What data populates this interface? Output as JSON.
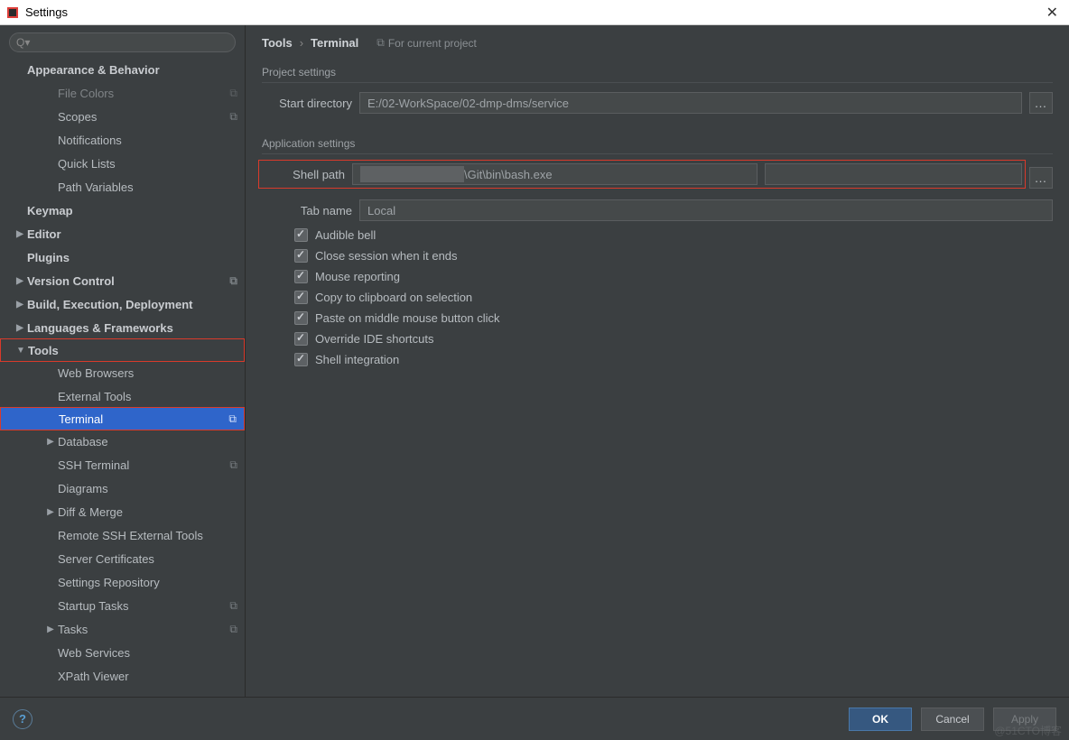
{
  "window": {
    "title": "Settings"
  },
  "search": {
    "placeholder": ""
  },
  "sidebar": {
    "items": [
      {
        "label": "Appearance & Behavior",
        "level": 0,
        "bold": true,
        "arrow": "",
        "badge": ""
      },
      {
        "label": "File Colors",
        "level": 2,
        "bold": false,
        "arrow": "",
        "badge": "⧉",
        "faded": true
      },
      {
        "label": "Scopes",
        "level": 2,
        "bold": false,
        "arrow": "",
        "badge": "⧉"
      },
      {
        "label": "Notifications",
        "level": 2,
        "bold": false,
        "arrow": "",
        "badge": ""
      },
      {
        "label": "Quick Lists",
        "level": 2,
        "bold": false,
        "arrow": "",
        "badge": ""
      },
      {
        "label": "Path Variables",
        "level": 2,
        "bold": false,
        "arrow": "",
        "badge": ""
      },
      {
        "label": "Keymap",
        "level": 0,
        "bold": true,
        "arrow": "",
        "badge": ""
      },
      {
        "label": "Editor",
        "level": 0,
        "bold": true,
        "arrow": "▶",
        "badge": ""
      },
      {
        "label": "Plugins",
        "level": 0,
        "bold": true,
        "arrow": "",
        "badge": ""
      },
      {
        "label": "Version Control",
        "level": 0,
        "bold": true,
        "arrow": "▶",
        "badge": "⧉"
      },
      {
        "label": "Build, Execution, Deployment",
        "level": 0,
        "bold": true,
        "arrow": "▶",
        "badge": ""
      },
      {
        "label": "Languages & Frameworks",
        "level": 0,
        "bold": true,
        "arrow": "▶",
        "badge": ""
      },
      {
        "label": "Tools",
        "level": 0,
        "bold": true,
        "arrow": "▼",
        "badge": "",
        "highlight_red": true
      },
      {
        "label": "Web Browsers",
        "level": 2,
        "bold": false,
        "arrow": "",
        "badge": ""
      },
      {
        "label": "External Tools",
        "level": 2,
        "bold": false,
        "arrow": "",
        "badge": ""
      },
      {
        "label": "Terminal",
        "level": 2,
        "bold": false,
        "arrow": "",
        "badge": "⧉",
        "selected": true,
        "highlight_red": true
      },
      {
        "label": "Database",
        "level": 2,
        "bold": false,
        "arrow": "▶",
        "badge": ""
      },
      {
        "label": "SSH Terminal",
        "level": 2,
        "bold": false,
        "arrow": "",
        "badge": "⧉"
      },
      {
        "label": "Diagrams",
        "level": 2,
        "bold": false,
        "arrow": "",
        "badge": ""
      },
      {
        "label": "Diff & Merge",
        "level": 2,
        "bold": false,
        "arrow": "▶",
        "badge": ""
      },
      {
        "label": "Remote SSH External Tools",
        "level": 2,
        "bold": false,
        "arrow": "",
        "badge": ""
      },
      {
        "label": "Server Certificates",
        "level": 2,
        "bold": false,
        "arrow": "",
        "badge": ""
      },
      {
        "label": "Settings Repository",
        "level": 2,
        "bold": false,
        "arrow": "",
        "badge": ""
      },
      {
        "label": "Startup Tasks",
        "level": 2,
        "bold": false,
        "arrow": "",
        "badge": "⧉"
      },
      {
        "label": "Tasks",
        "level": 2,
        "bold": false,
        "arrow": "▶",
        "badge": "⧉"
      },
      {
        "label": "Web Services",
        "level": 2,
        "bold": false,
        "arrow": "",
        "badge": ""
      },
      {
        "label": "XPath Viewer",
        "level": 2,
        "bold": false,
        "arrow": "",
        "badge": ""
      }
    ]
  },
  "breadcrumb": {
    "root": "Tools",
    "sep": "›",
    "leaf": "Terminal",
    "for_project": "For current project"
  },
  "sections": {
    "project_settings": "Project settings",
    "application_settings": "Application settings"
  },
  "fields": {
    "start_directory": {
      "label": "Start directory",
      "value": "E:/02-WorkSpace/02-dmp-dms/service"
    },
    "shell_path": {
      "label": "Shell path",
      "value_suffix": "\\Git\\bin\\bash.exe"
    },
    "tab_name": {
      "label": "Tab name",
      "value": "Local"
    }
  },
  "checkboxes": [
    {
      "label": "Audible bell",
      "checked": true
    },
    {
      "label": "Close session when it ends",
      "checked": true
    },
    {
      "label": "Mouse reporting",
      "checked": true
    },
    {
      "label": "Copy to clipboard on selection",
      "checked": true
    },
    {
      "label": "Paste on middle mouse button click",
      "checked": true
    },
    {
      "label": "Override IDE shortcuts",
      "checked": true
    },
    {
      "label": "Shell integration",
      "checked": true
    }
  ],
  "footer": {
    "ok": "OK",
    "cancel": "Cancel",
    "apply": "Apply",
    "help": "?"
  },
  "watermark": "@51CTO博客"
}
